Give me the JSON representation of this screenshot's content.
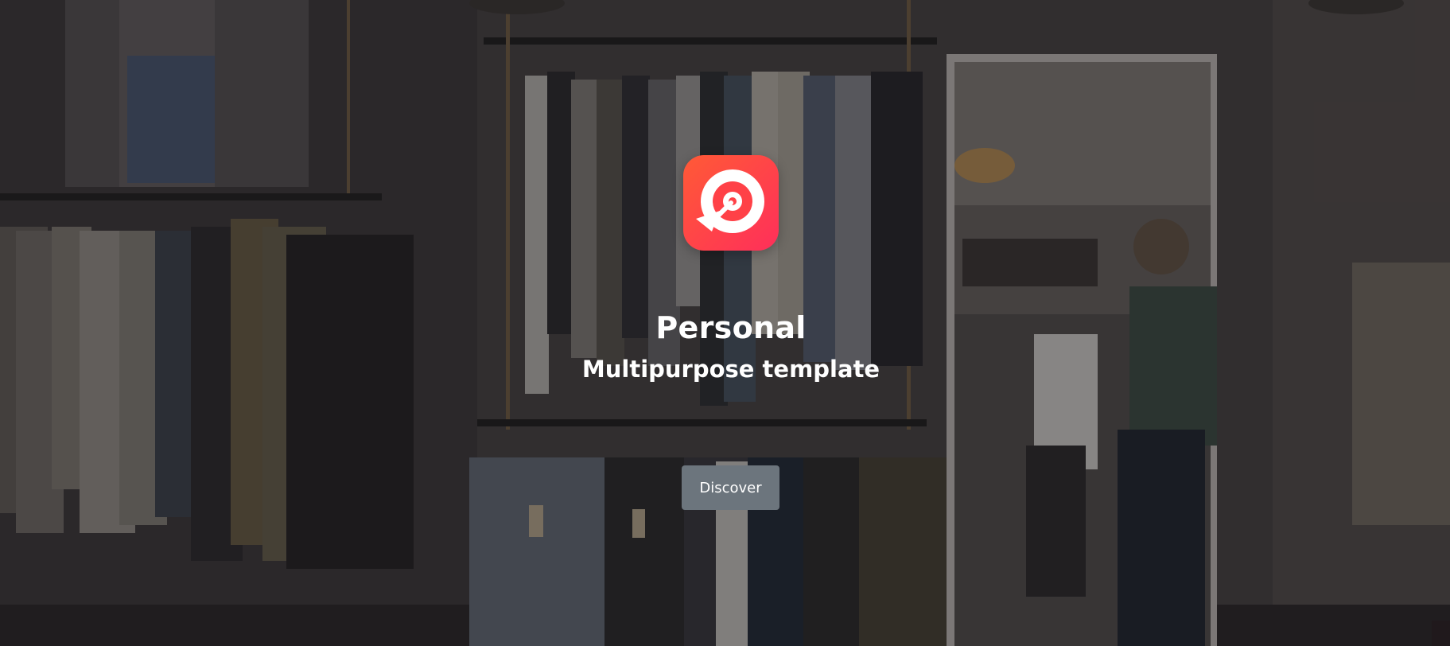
{
  "hero": {
    "title": "Personal",
    "subtitle": "Multipurpose template",
    "logo_icon": "target-arrow-icon",
    "button_label": "Discover"
  },
  "colors": {
    "logo_gradient_start": "#ff5a36",
    "logo_gradient_end": "#ff2f5a",
    "button_background": "#6c757d",
    "text": "#ffffff"
  }
}
